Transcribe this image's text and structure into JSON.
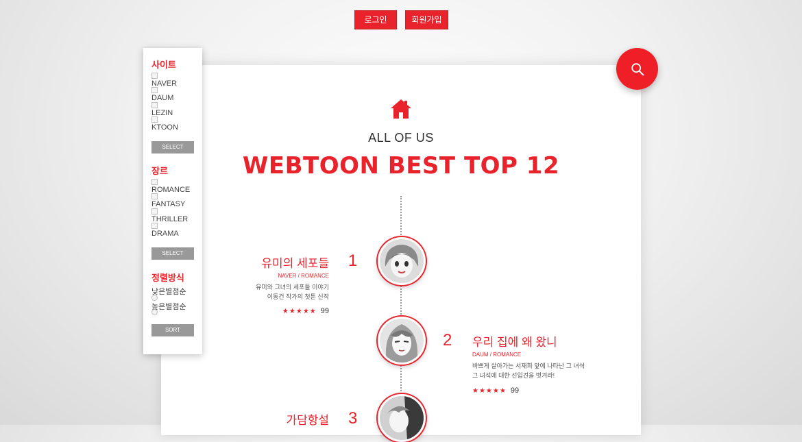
{
  "header": {
    "login_label": "로그인",
    "join_label": "회원가입"
  },
  "hero": {
    "subtitle": "ALL OF US",
    "headline": "WEBTOON BEST TOP 12"
  },
  "sidebar": {
    "site_title": "사이트",
    "sites": [
      "NAVER",
      "DAUM",
      "LEZIN",
      "KTOON"
    ],
    "site_select_label": "SELECT",
    "genre_title": "장르",
    "genres": [
      "ROMANCE",
      "FANTASY",
      "THRILLER",
      "DRAMA"
    ],
    "genre_select_label": "SELECT",
    "sort_title": "정렬방식",
    "sort_options": [
      "낮은별점순",
      "높은별점순"
    ],
    "sort_button_label": "SORT"
  },
  "list": [
    {
      "rank": "1",
      "title": "유미의 세포들",
      "meta": "NAVER / ROMANCE",
      "desc_line1": "유미와 그녀의 세포들 이야기",
      "desc_line2": "이동건 작가의 첫툰 신작",
      "stars": "★★★★★",
      "score": "99"
    },
    {
      "rank": "2",
      "title": "우리 집에 왜 왔니",
      "meta": "DAUM / ROMANCE",
      "desc_line1": "바쁘게 살아가는 서재희 앞에 나타난 그 녀석",
      "desc_line2": "그 녀석에 대한 선입견을 벗겨라!",
      "stars": "★★★★★",
      "score": "99"
    },
    {
      "rank": "3",
      "title": "가담항설"
    }
  ],
  "colors": {
    "accent": "#e8232b",
    "sidebar_button": "#999999"
  },
  "icons": {
    "home": "home-icon",
    "search": "search-icon"
  }
}
